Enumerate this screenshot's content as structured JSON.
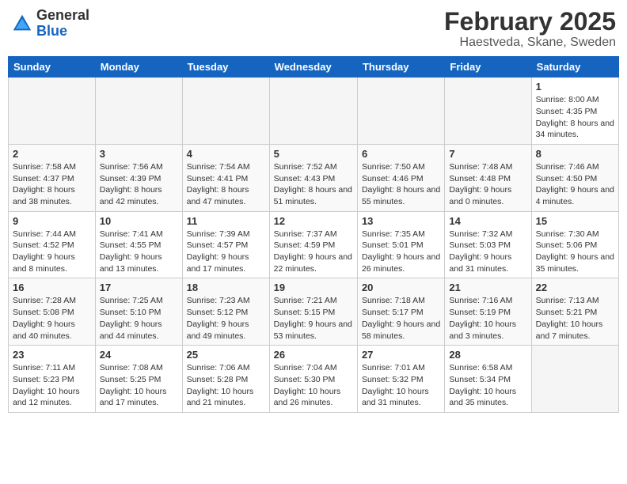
{
  "header": {
    "logo_general": "General",
    "logo_blue": "Blue",
    "month": "February 2025",
    "location": "Haestveda, Skane, Sweden"
  },
  "days_of_week": [
    "Sunday",
    "Monday",
    "Tuesday",
    "Wednesday",
    "Thursday",
    "Friday",
    "Saturday"
  ],
  "weeks": [
    [
      {
        "day": "",
        "info": ""
      },
      {
        "day": "",
        "info": ""
      },
      {
        "day": "",
        "info": ""
      },
      {
        "day": "",
        "info": ""
      },
      {
        "day": "",
        "info": ""
      },
      {
        "day": "",
        "info": ""
      },
      {
        "day": "1",
        "info": "Sunrise: 8:00 AM\nSunset: 4:35 PM\nDaylight: 8 hours and 34 minutes."
      }
    ],
    [
      {
        "day": "2",
        "info": "Sunrise: 7:58 AM\nSunset: 4:37 PM\nDaylight: 8 hours and 38 minutes."
      },
      {
        "day": "3",
        "info": "Sunrise: 7:56 AM\nSunset: 4:39 PM\nDaylight: 8 hours and 42 minutes."
      },
      {
        "day": "4",
        "info": "Sunrise: 7:54 AM\nSunset: 4:41 PM\nDaylight: 8 hours and 47 minutes."
      },
      {
        "day": "5",
        "info": "Sunrise: 7:52 AM\nSunset: 4:43 PM\nDaylight: 8 hours and 51 minutes."
      },
      {
        "day": "6",
        "info": "Sunrise: 7:50 AM\nSunset: 4:46 PM\nDaylight: 8 hours and 55 minutes."
      },
      {
        "day": "7",
        "info": "Sunrise: 7:48 AM\nSunset: 4:48 PM\nDaylight: 9 hours and 0 minutes."
      },
      {
        "day": "8",
        "info": "Sunrise: 7:46 AM\nSunset: 4:50 PM\nDaylight: 9 hours and 4 minutes."
      }
    ],
    [
      {
        "day": "9",
        "info": "Sunrise: 7:44 AM\nSunset: 4:52 PM\nDaylight: 9 hours and 8 minutes."
      },
      {
        "day": "10",
        "info": "Sunrise: 7:41 AM\nSunset: 4:55 PM\nDaylight: 9 hours and 13 minutes."
      },
      {
        "day": "11",
        "info": "Sunrise: 7:39 AM\nSunset: 4:57 PM\nDaylight: 9 hours and 17 minutes."
      },
      {
        "day": "12",
        "info": "Sunrise: 7:37 AM\nSunset: 4:59 PM\nDaylight: 9 hours and 22 minutes."
      },
      {
        "day": "13",
        "info": "Sunrise: 7:35 AM\nSunset: 5:01 PM\nDaylight: 9 hours and 26 minutes."
      },
      {
        "day": "14",
        "info": "Sunrise: 7:32 AM\nSunset: 5:03 PM\nDaylight: 9 hours and 31 minutes."
      },
      {
        "day": "15",
        "info": "Sunrise: 7:30 AM\nSunset: 5:06 PM\nDaylight: 9 hours and 35 minutes."
      }
    ],
    [
      {
        "day": "16",
        "info": "Sunrise: 7:28 AM\nSunset: 5:08 PM\nDaylight: 9 hours and 40 minutes."
      },
      {
        "day": "17",
        "info": "Sunrise: 7:25 AM\nSunset: 5:10 PM\nDaylight: 9 hours and 44 minutes."
      },
      {
        "day": "18",
        "info": "Sunrise: 7:23 AM\nSunset: 5:12 PM\nDaylight: 9 hours and 49 minutes."
      },
      {
        "day": "19",
        "info": "Sunrise: 7:21 AM\nSunset: 5:15 PM\nDaylight: 9 hours and 53 minutes."
      },
      {
        "day": "20",
        "info": "Sunrise: 7:18 AM\nSunset: 5:17 PM\nDaylight: 9 hours and 58 minutes."
      },
      {
        "day": "21",
        "info": "Sunrise: 7:16 AM\nSunset: 5:19 PM\nDaylight: 10 hours and 3 minutes."
      },
      {
        "day": "22",
        "info": "Sunrise: 7:13 AM\nSunset: 5:21 PM\nDaylight: 10 hours and 7 minutes."
      }
    ],
    [
      {
        "day": "23",
        "info": "Sunrise: 7:11 AM\nSunset: 5:23 PM\nDaylight: 10 hours and 12 minutes."
      },
      {
        "day": "24",
        "info": "Sunrise: 7:08 AM\nSunset: 5:25 PM\nDaylight: 10 hours and 17 minutes."
      },
      {
        "day": "25",
        "info": "Sunrise: 7:06 AM\nSunset: 5:28 PM\nDaylight: 10 hours and 21 minutes."
      },
      {
        "day": "26",
        "info": "Sunrise: 7:04 AM\nSunset: 5:30 PM\nDaylight: 10 hours and 26 minutes."
      },
      {
        "day": "27",
        "info": "Sunrise: 7:01 AM\nSunset: 5:32 PM\nDaylight: 10 hours and 31 minutes."
      },
      {
        "day": "28",
        "info": "Sunrise: 6:58 AM\nSunset: 5:34 PM\nDaylight: 10 hours and 35 minutes."
      },
      {
        "day": "",
        "info": ""
      }
    ]
  ]
}
